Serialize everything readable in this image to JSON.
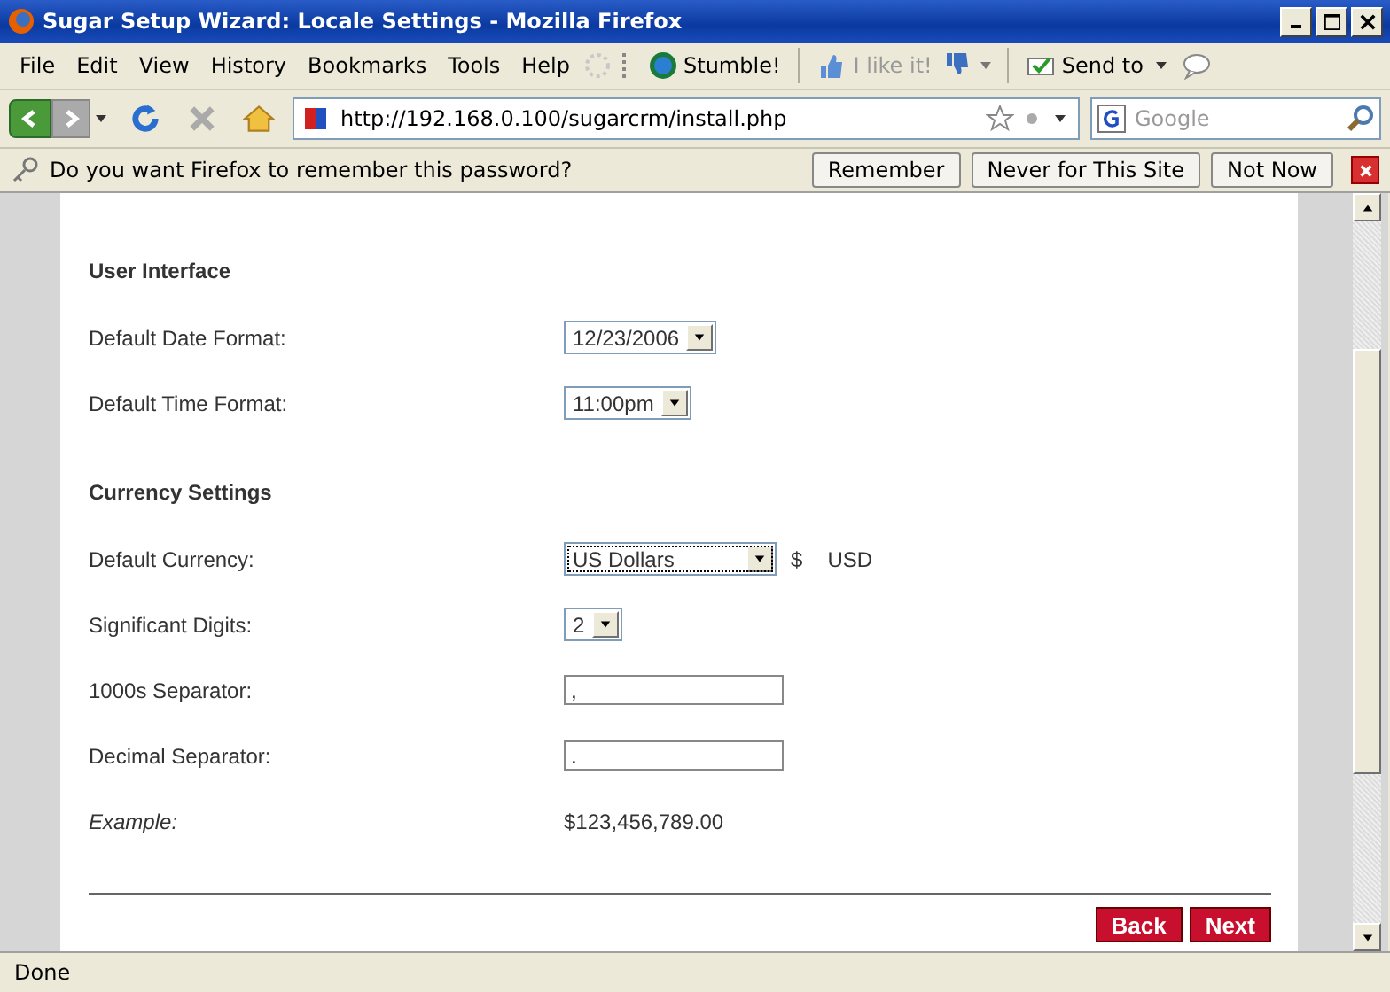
{
  "window": {
    "title": "Sugar Setup Wizard: Locale Settings - Mozilla Firefox"
  },
  "menu": [
    "File",
    "Edit",
    "View",
    "History",
    "Bookmarks",
    "Tools",
    "Help"
  ],
  "toolbar": {
    "stumble": "Stumble!",
    "like": "I like it!",
    "send": "Send to"
  },
  "address": {
    "url": "http://192.168.0.100/sugarcrm/install.php"
  },
  "search": {
    "placeholder": "Google"
  },
  "password_bar": {
    "text": "Do you want Firefox to remember this password?",
    "buttons": [
      "Remember",
      "Never for This Site",
      "Not Now"
    ]
  },
  "sections": [
    {
      "title": "User Interface",
      "fields": [
        {
          "label": "Default Date Format:",
          "kind": "select",
          "value": "12/23/2006"
        },
        {
          "label": "Default Time Format:",
          "kind": "select",
          "value": "11:00pm"
        }
      ]
    },
    {
      "title": "Currency Settings",
      "fields": [
        {
          "label": "Default Currency:",
          "kind": "select",
          "value": "US Dollars",
          "extra": [
            "$",
            "USD"
          ]
        },
        {
          "label": "Significant Digits:",
          "kind": "select",
          "value": "2"
        },
        {
          "label": "1000s Separator:",
          "kind": "input",
          "value": ","
        },
        {
          "label": "Decimal Separator:",
          "kind": "input",
          "value": "."
        },
        {
          "label": "Example:",
          "kind": "text",
          "value": "$123,456,789.00"
        }
      ]
    }
  ],
  "buttons": [
    "Back",
    "Next"
  ],
  "status_bar": {
    "text": "Done"
  }
}
